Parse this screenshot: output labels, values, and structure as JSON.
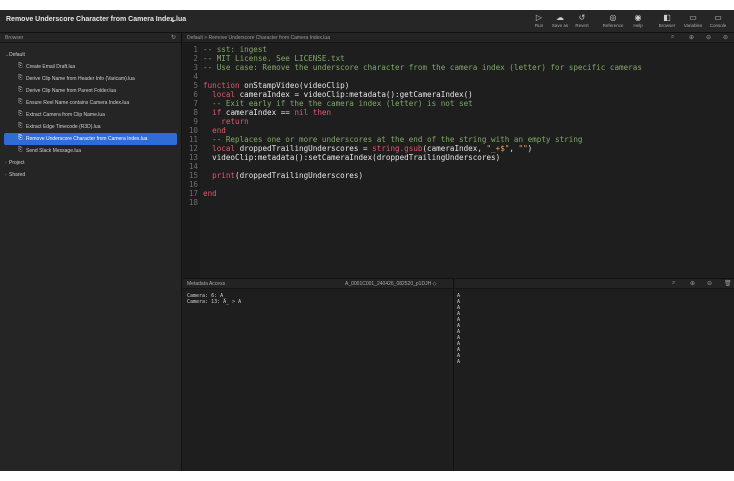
{
  "window": {
    "title": "Remove Underscore Character from Camera Index.lua"
  },
  "toolbar": {
    "items": [
      {
        "label": "Run",
        "icon": "play-icon",
        "glyph": "▷"
      },
      {
        "label": "Save as",
        "icon": "cloud-icon",
        "glyph": "☁"
      },
      {
        "label": "Revert",
        "icon": "revert-icon",
        "glyph": "↺"
      },
      {
        "label": "Reference",
        "icon": "reference-icon",
        "glyph": "◎"
      },
      {
        "label": "Help",
        "icon": "help-icon",
        "glyph": "◉"
      },
      {
        "label": "Browser",
        "icon": "browser-panel-icon",
        "glyph": "◧"
      },
      {
        "label": "Variables",
        "icon": "variables-panel-icon",
        "glyph": "▭"
      },
      {
        "label": "Console",
        "icon": "console-panel-icon",
        "glyph": "▭"
      }
    ]
  },
  "sidebar": {
    "header": "Browser",
    "groups": [
      {
        "label": "Default",
        "expanded": true
      },
      {
        "label": "Project",
        "expanded": false
      },
      {
        "label": "Shared",
        "expanded": false
      }
    ],
    "files": [
      "Create Email Draft.lua",
      "Derive Clip Name from Header Info (Varicam).lua",
      "Derive Clip Name from Parent Folder.lua",
      "Ensure Reel Name contains Camera Index.lua",
      "Extract Camera from Clip Name.lua",
      "Extract Edge Timecode (R3D).lua",
      "Remove Underscore Character from Camera Index.lua",
      "Send Slack Message.lua"
    ],
    "selected_index": 6
  },
  "editor": {
    "breadcrumb": "Default > Remove Underscore Character from Camera Index.lua",
    "lines": [
      "1",
      "2",
      "3",
      "4",
      "5",
      "6",
      "7",
      "8",
      "9",
      "10",
      "11",
      "12",
      "13",
      "14",
      "15",
      "16",
      "17",
      "18"
    ],
    "code": {
      "l1": "-- sst: ingest",
      "l2": "-- MIT License. See LICENSE.txt",
      "l3": "-- Use case: Remove the underscore character from the camera index (letter) for specific cameras",
      "l5a": "function",
      "l5b": " onStampVideo(videoClip)",
      "l6a": "  local",
      "l6b": " cameraIndex = videoClip:metadata():getCameraIndex()",
      "l7": "  -- Exit early if the the camera index (letter) is not set",
      "l8a": "  if",
      "l8b": " cameraIndex == ",
      "l8c": "nil",
      "l8d": " ",
      "l8e": "then",
      "l9": "    return",
      "l10": "  end",
      "l11": "  -- Replaces one or more underscores at the end of the string with an empty string",
      "l12a": "  local",
      "l12b": " droppedTrailingUnderscores = ",
      "l12c": "string.gsub",
      "l12d": "(cameraIndex, ",
      "l12e": "\"_+$\"",
      "l12f": ", ",
      "l12g": "\"\"",
      "l12h": ")",
      "l13": "  videoClip:metadata():setCameraIndex(droppedTrailingUnderscores)",
      "l15a": "  print",
      "l15b": "(droppedTrailingUnderscores)",
      "l17": "end"
    }
  },
  "metadata_panel": {
    "title": "Metadata Access",
    "clip": "A_0001C001_240426_082520_p1DJH ◇",
    "output": [
      "Camera: 6: A_",
      "Camera: 13: A_ > A"
    ]
  },
  "console": {
    "output": [
      "A",
      "A",
      "A",
      "A",
      "A",
      "A",
      "A",
      "A",
      "A",
      "A",
      "A",
      "A"
    ]
  }
}
